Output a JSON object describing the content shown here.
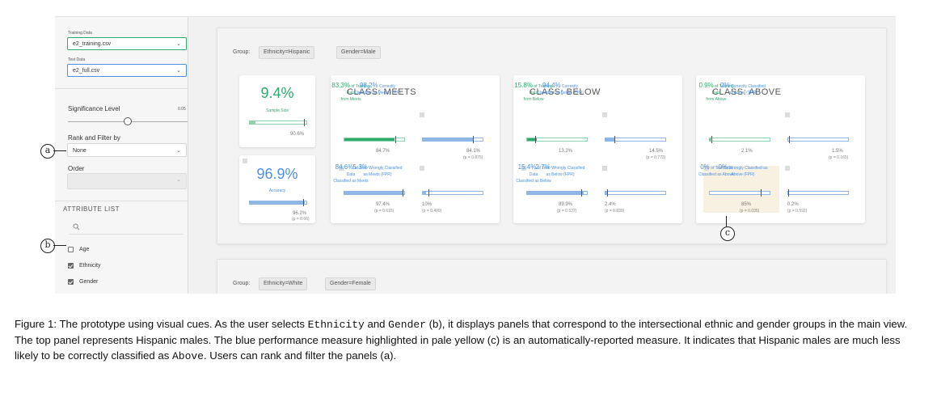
{
  "sidebar": {
    "training_label": "Training Data",
    "training_value": "e2_training.csv",
    "test_label": "Test Data",
    "test_value": "e2_full.csv",
    "significance_label": "Significance Level",
    "significance_value": "0.05",
    "rank_label": "Rank and Filter by",
    "rank_value": "None",
    "order_label": "Order",
    "order_value": "",
    "attribute_list_label": "ATTRIBUTE LIST",
    "attributes": [
      {
        "label": "Age",
        "checked": false
      },
      {
        "label": "Ethnicity",
        "checked": true
      },
      {
        "label": "Gender",
        "checked": true
      }
    ]
  },
  "groups": [
    {
      "label": "Group:",
      "chips": [
        "Ethnicity=Hispanic",
        "Gender=Male"
      ]
    },
    {
      "label": "Group:",
      "chips": [
        "Ethnicity=White",
        "Gender=Female"
      ]
    }
  ],
  "summary": {
    "sample_size_value": "9.4%",
    "sample_size_label": "Sample Size",
    "sample_size_fill": 0.094,
    "sample_size_ref": "90.6%",
    "accuracy_value": "96.9%",
    "accuracy_label": "Accuracy",
    "accuracy_fill": 0.969,
    "accuracy_ref": "96.2%",
    "accuracy_p": "(p = 0.66)"
  },
  "classes": [
    {
      "title": "CLASS: MEETS",
      "training": {
        "value": "83.3%",
        "text1": "of Training Data",
        "text2": "from Meets",
        "fill": 0.833,
        "ref": "84.7%"
      },
      "test": {
        "value": "84.6%",
        "text1": "of Test Data",
        "text2": "Classified as Meets",
        "fill": 0.846,
        "ref": "84.1%",
        "p": "(p = 0.875)"
      },
      "tpr": {
        "value": "98.2%",
        "text1": "Correctly",
        "text2": "Classified as Meets (TPR)",
        "fill": 0.982,
        "ref": "97.4%",
        "p": "(p = 0.615)"
      },
      "fpr": {
        "value": "5.3%",
        "text1": "Wrongly Classified",
        "text2": "as Meets (FPR)",
        "fill": 0.053,
        "ref": "10%",
        "p": "(p = 0.499)"
      }
    },
    {
      "title": "CLASS: BELOW",
      "training": {
        "value": "15.8%",
        "text1": "of Training Data",
        "text2": "from Below",
        "fill": 0.158,
        "ref": "13.2%"
      },
      "test": {
        "value": "15.4%",
        "text1": "of Test Data",
        "text2": "Classified as Below",
        "fill": 0.154,
        "ref": "14.5%",
        "p": "(p = 0.773)"
      },
      "tpr": {
        "value": "94.4%",
        "text1": "Correctly",
        "text2": "Classified as Below (TPR)",
        "fill": 0.944,
        "ref": "89.9%",
        "p": "(p = 0.537)"
      },
      "fpr": {
        "value": "2.7%",
        "text1": "Wrongly Classified",
        "text2": "as Below (FPR)",
        "fill": 0.027,
        "ref": "2.4%",
        "p": "(p = 0.839)"
      }
    },
    {
      "title": "CLASS: ABOVE",
      "training": {
        "value": "0.9%",
        "text1": "of Training Data",
        "text2": "from Above",
        "fill": 0.009,
        "ref": "2.1%"
      },
      "test": {
        "value": "0%",
        "text1": "of Test Data",
        "text2": "Classified as Above",
        "fill": 0.0,
        "ref": "1.5%",
        "p": "(p = 0.165)"
      },
      "tpr": {
        "value": "0%",
        "text1": "Correctly Classified",
        "text2": "as Above (TPR)",
        "fill": 0.0,
        "ref": "85%",
        "p": "(p = 0.035)"
      },
      "fpr": {
        "value": "0%",
        "text1": "Wrongly Classified as",
        "text2": "Above (FPR)",
        "fill": 0.0,
        "ref": "0.2%",
        "p": "(p = 0.592)"
      }
    }
  ],
  "annotations": {
    "a": "a",
    "b": "b",
    "c": "c"
  },
  "colors": {
    "green": "#2eaa6c",
    "blue": "#4a90e2",
    "highlight": "#f8f1e2"
  },
  "caption": {
    "p1": "Figure 1: The prototype using visual cues. As the user selects ",
    "code1": "Ethnicity",
    "p2": " and ",
    "code2": "Gender",
    "p3": " (b), it displays panels that correspond to the intersectional ethnic and gender groups in the main view. The top panel represents Hispanic males. The blue performance measure highlighted in pale yellow (c) is an automatically-reported measure. It indicates that Hispanic males are much less likely to be correctly classified as ",
    "code3": "Above",
    "p4": ". Users can rank and filter the panels (a)."
  }
}
